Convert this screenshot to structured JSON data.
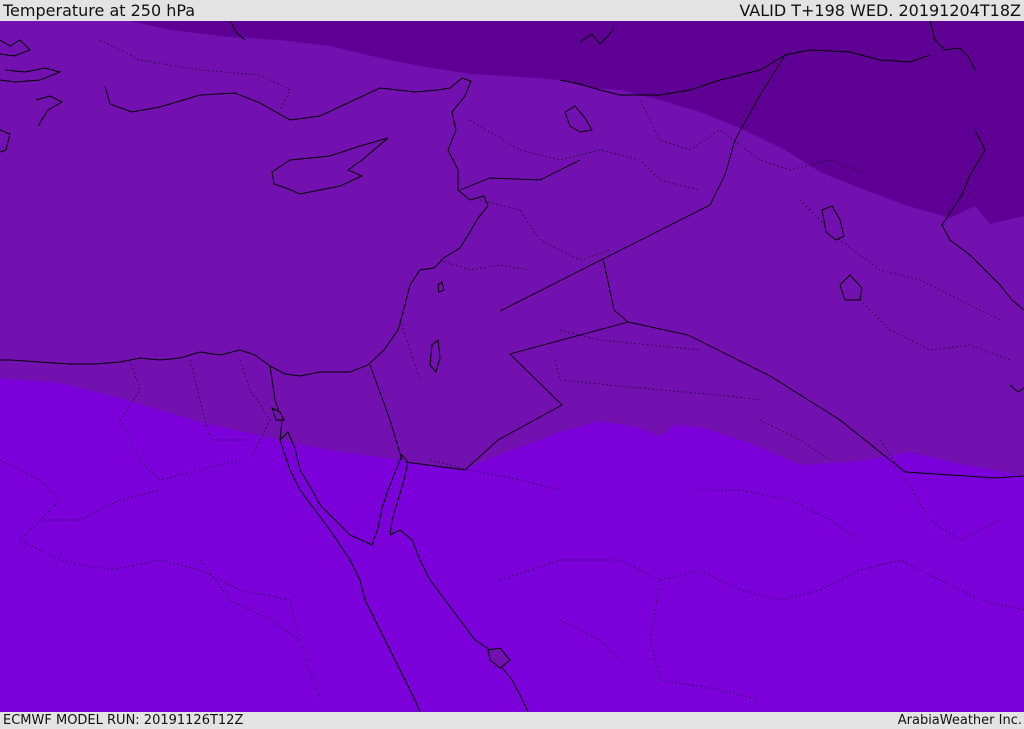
{
  "header": {
    "title": "Temperature at 250 hPa",
    "valid": "VALID T+198 WED. 20191204T18Z"
  },
  "footer": {
    "model_run": "ECMWF MODEL RUN: 20191126T12Z",
    "credit": "ArabiaWeather Inc."
  },
  "map": {
    "colors": {
      "coldest_band": "#5f0095",
      "middle_band": "#7310b0",
      "warmest_band": "#7b00d9"
    }
  }
}
